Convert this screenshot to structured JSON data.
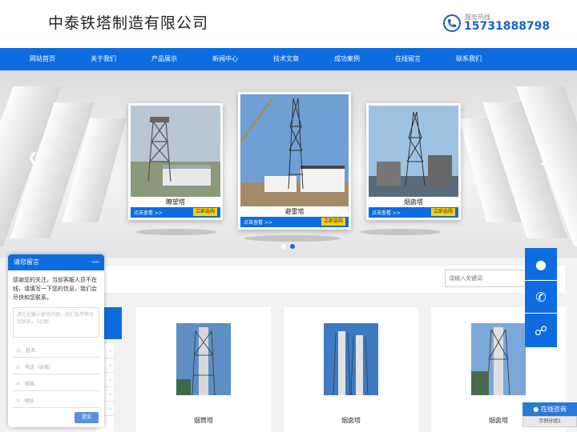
{
  "header": {
    "company_name": "中泰铁塔制造有限公司",
    "hotline_label": "服务热线",
    "hotline_number": "15731888798"
  },
  "nav": [
    "网站首页",
    "关于我们",
    "产品展示",
    "新闻中心",
    "技术文章",
    "成功案例",
    "在线留言",
    "联系我们"
  ],
  "carousel": {
    "slides": [
      {
        "caption": "瞭望塔",
        "more": "点击查看 >>",
        "action": "立即选购"
      },
      {
        "caption": "避雷塔",
        "more": "点击查看 >>",
        "action": "立即选购"
      },
      {
        "caption": "烟囱塔",
        "more": "点击查看 >>",
        "action": "立即选购"
      }
    ],
    "active_index": 1
  },
  "search": {
    "placeholder": "请输入关键词"
  },
  "products": [
    {
      "name": "烟筒塔"
    },
    {
      "name": "烟囱塔"
    },
    {
      "name": "烟囱塔"
    }
  ],
  "message_box": {
    "title": "请您留言",
    "intro": "感谢您的关注，当前客服人员不在线，请填写一下您的信息，我们会尽快和您联系。",
    "content_placeholder": "请在此输入留言内容，我们会尽快与您联系。（必填）",
    "fields": [
      {
        "icon": "user-icon",
        "label": "姓名"
      },
      {
        "icon": "phone-icon",
        "label": "电话（必填）"
      },
      {
        "icon": "mail-icon",
        "label": "邮箱"
      },
      {
        "icon": "location-icon",
        "label": "地址"
      }
    ],
    "submit": "提交"
  },
  "float_bar": {
    "online_label": "在线咨询",
    "group_label": "示例分组1"
  },
  "colors": {
    "primary": "#0d6de0",
    "accent": "#ffd200",
    "hotline": "#1565c0"
  }
}
